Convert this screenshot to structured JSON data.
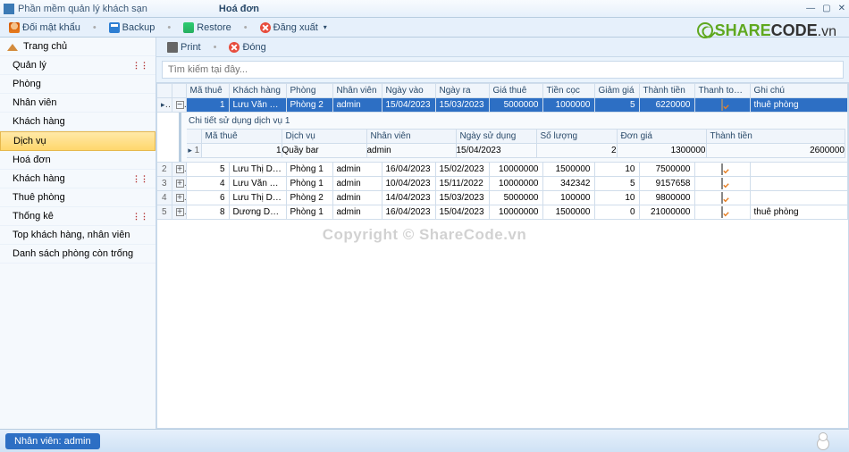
{
  "app": {
    "title": "Phần mềm quản lý khách sạn",
    "tab": "Hoá đơn"
  },
  "toolbar": {
    "change_pw": "Đối mật khẩu",
    "backup": "Backup",
    "restore": "Restore",
    "logout": "Đăng xuất"
  },
  "content_toolbar": {
    "print": "Print",
    "close": "Đóng"
  },
  "search": {
    "placeholder": "Tìm kiếm tại đây..."
  },
  "sidebar": {
    "items": [
      {
        "label": "Trang chủ"
      },
      {
        "label": "Quản lý"
      },
      {
        "label": "Phòng"
      },
      {
        "label": "Nhân viên"
      },
      {
        "label": "Khách hàng"
      },
      {
        "label": "Dịch vụ"
      },
      {
        "label": "Hoá đơn"
      },
      {
        "label": "Khách hàng"
      },
      {
        "label": "Thuê phòng"
      },
      {
        "label": "Thống kê"
      },
      {
        "label": "Top khách hàng, nhân viên"
      },
      {
        "label": "Danh sách phòng còn trống"
      }
    ]
  },
  "grid": {
    "columns": [
      "Mã thuê",
      "Khách hàng",
      "Phòng",
      "Nhân viên",
      "Ngày vào",
      "Ngày ra",
      "Giá thuê",
      "Tiền cọc",
      "Giảm giá",
      "Thành tiền",
      "Thanh toán?",
      "Ghi chú"
    ],
    "rows": [
      {
        "id": "1",
        "kh": "Lưu Văn Tươi",
        "ph": "Phòng 2",
        "nv": "admin",
        "vao": "15/04/2023",
        "ra": "15/03/2023",
        "gia": "5000000",
        "coc": "1000000",
        "gg": "5",
        "tt": "6220000",
        "paid": true,
        "note": "thuê phòng",
        "expanded": true
      },
      {
        "id": "5",
        "kh": "Lưu Thị Dung",
        "ph": "Phòng 1",
        "nv": "admin",
        "vao": "16/04/2023",
        "ra": "15/02/2023",
        "gia": "10000000",
        "coc": "1500000",
        "gg": "10",
        "tt": "7500000",
        "paid": true,
        "note": ""
      },
      {
        "id": "4",
        "kh": "Lưu Văn Tươi",
        "ph": "Phòng 1",
        "nv": "admin",
        "vao": "10/04/2023",
        "ra": "15/11/2022",
        "gia": "10000000",
        "coc": "342342",
        "gg": "5",
        "tt": "9157658",
        "paid": true,
        "note": ""
      },
      {
        "id": "6",
        "kh": "Lưu Thị Dung",
        "ph": "Phòng 2",
        "nv": "admin",
        "vao": "14/04/2023",
        "ra": "15/03/2023",
        "gia": "5000000",
        "coc": "100000",
        "gg": "10",
        "tt": "9800000",
        "paid": true,
        "note": ""
      },
      {
        "id": "8",
        "kh": "Dương Duy N...",
        "ph": "Phòng 1",
        "nv": "admin",
        "vao": "16/04/2023",
        "ra": "15/04/2023",
        "gia": "10000000",
        "coc": "1500000",
        "gg": "0",
        "tt": "21000000",
        "paid": true,
        "note": "thuê phòng"
      }
    ],
    "detail": {
      "title": "Chi tiết sử dụng dịch vụ 1",
      "columns": [
        "Mã thuê",
        "Dịch vụ",
        "Nhân viên",
        "Ngày sử dụng",
        "Số lượng",
        "Đơn giá",
        "Thành tiền"
      ],
      "rows": [
        {
          "ma": "1",
          "dv": "Quầy bar",
          "nv": "admin",
          "ngay": "15/04/2023",
          "sl": "2",
          "dg": "1300000",
          "tt": "2600000"
        }
      ]
    }
  },
  "status": {
    "label": "Nhân viên:",
    "user": "admin"
  },
  "logo": {
    "share": "SHARE",
    "code": "CODE",
    "vn": ".vn"
  },
  "watermark": "Copyright © ShareCode.vn"
}
